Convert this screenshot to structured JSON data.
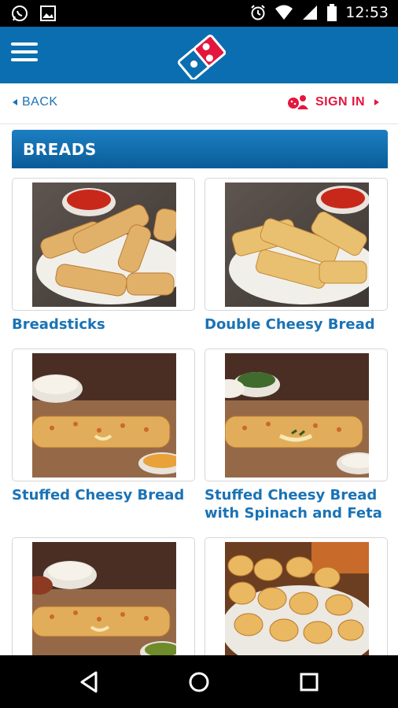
{
  "status_bar": {
    "time": "12:53",
    "icons": [
      "whatsapp-icon",
      "image-icon",
      "alarm-icon",
      "wifi-icon",
      "signal-icon",
      "battery-icon"
    ]
  },
  "header": {
    "brand_color": "#0b6eb0",
    "logo": "dominos-logo"
  },
  "nav": {
    "back_label": "BACK",
    "signin_label": "SIGN IN"
  },
  "section": {
    "title": "BREADS"
  },
  "products": [
    {
      "name": "Breadsticks"
    },
    {
      "name": "Double Cheesy Bread"
    },
    {
      "name": "Stuffed Cheesy Bread"
    },
    {
      "name": "Stuffed Cheesy Bread with Spinach and Feta"
    },
    {
      "name": ""
    },
    {
      "name": ""
    }
  ],
  "colors": {
    "link_blue": "#1a73b5",
    "signin_red": "#e3173e",
    "header_gradient_top": "#1c7fc2",
    "header_gradient_bottom": "#0a5c98"
  }
}
